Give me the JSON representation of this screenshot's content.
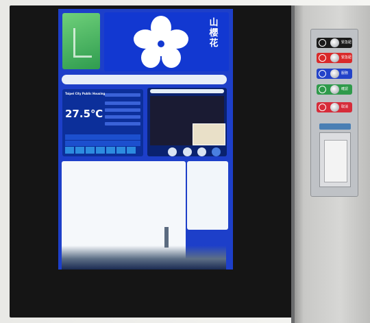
{
  "screen": {
    "vertical_title": "山櫻花",
    "weather": {
      "location": "Taipei City Public Housing",
      "temperature": "27.5℃"
    }
  },
  "button_panel": {
    "buttons": [
      {
        "label": "緊急鈕",
        "color": "#1b1b1b",
        "icon": "phone-icon"
      },
      {
        "label": "緊急鈕",
        "color": "#d92a2a",
        "icon": "power-icon"
      },
      {
        "label": "服務",
        "color": "#2343c9",
        "icon": "refresh-icon"
      },
      {
        "label": "確認",
        "color": "#2f9a4b",
        "icon": "check-icon"
      },
      {
        "label": "取消",
        "color": "#d62c3a",
        "icon": "close-icon"
      }
    ]
  }
}
